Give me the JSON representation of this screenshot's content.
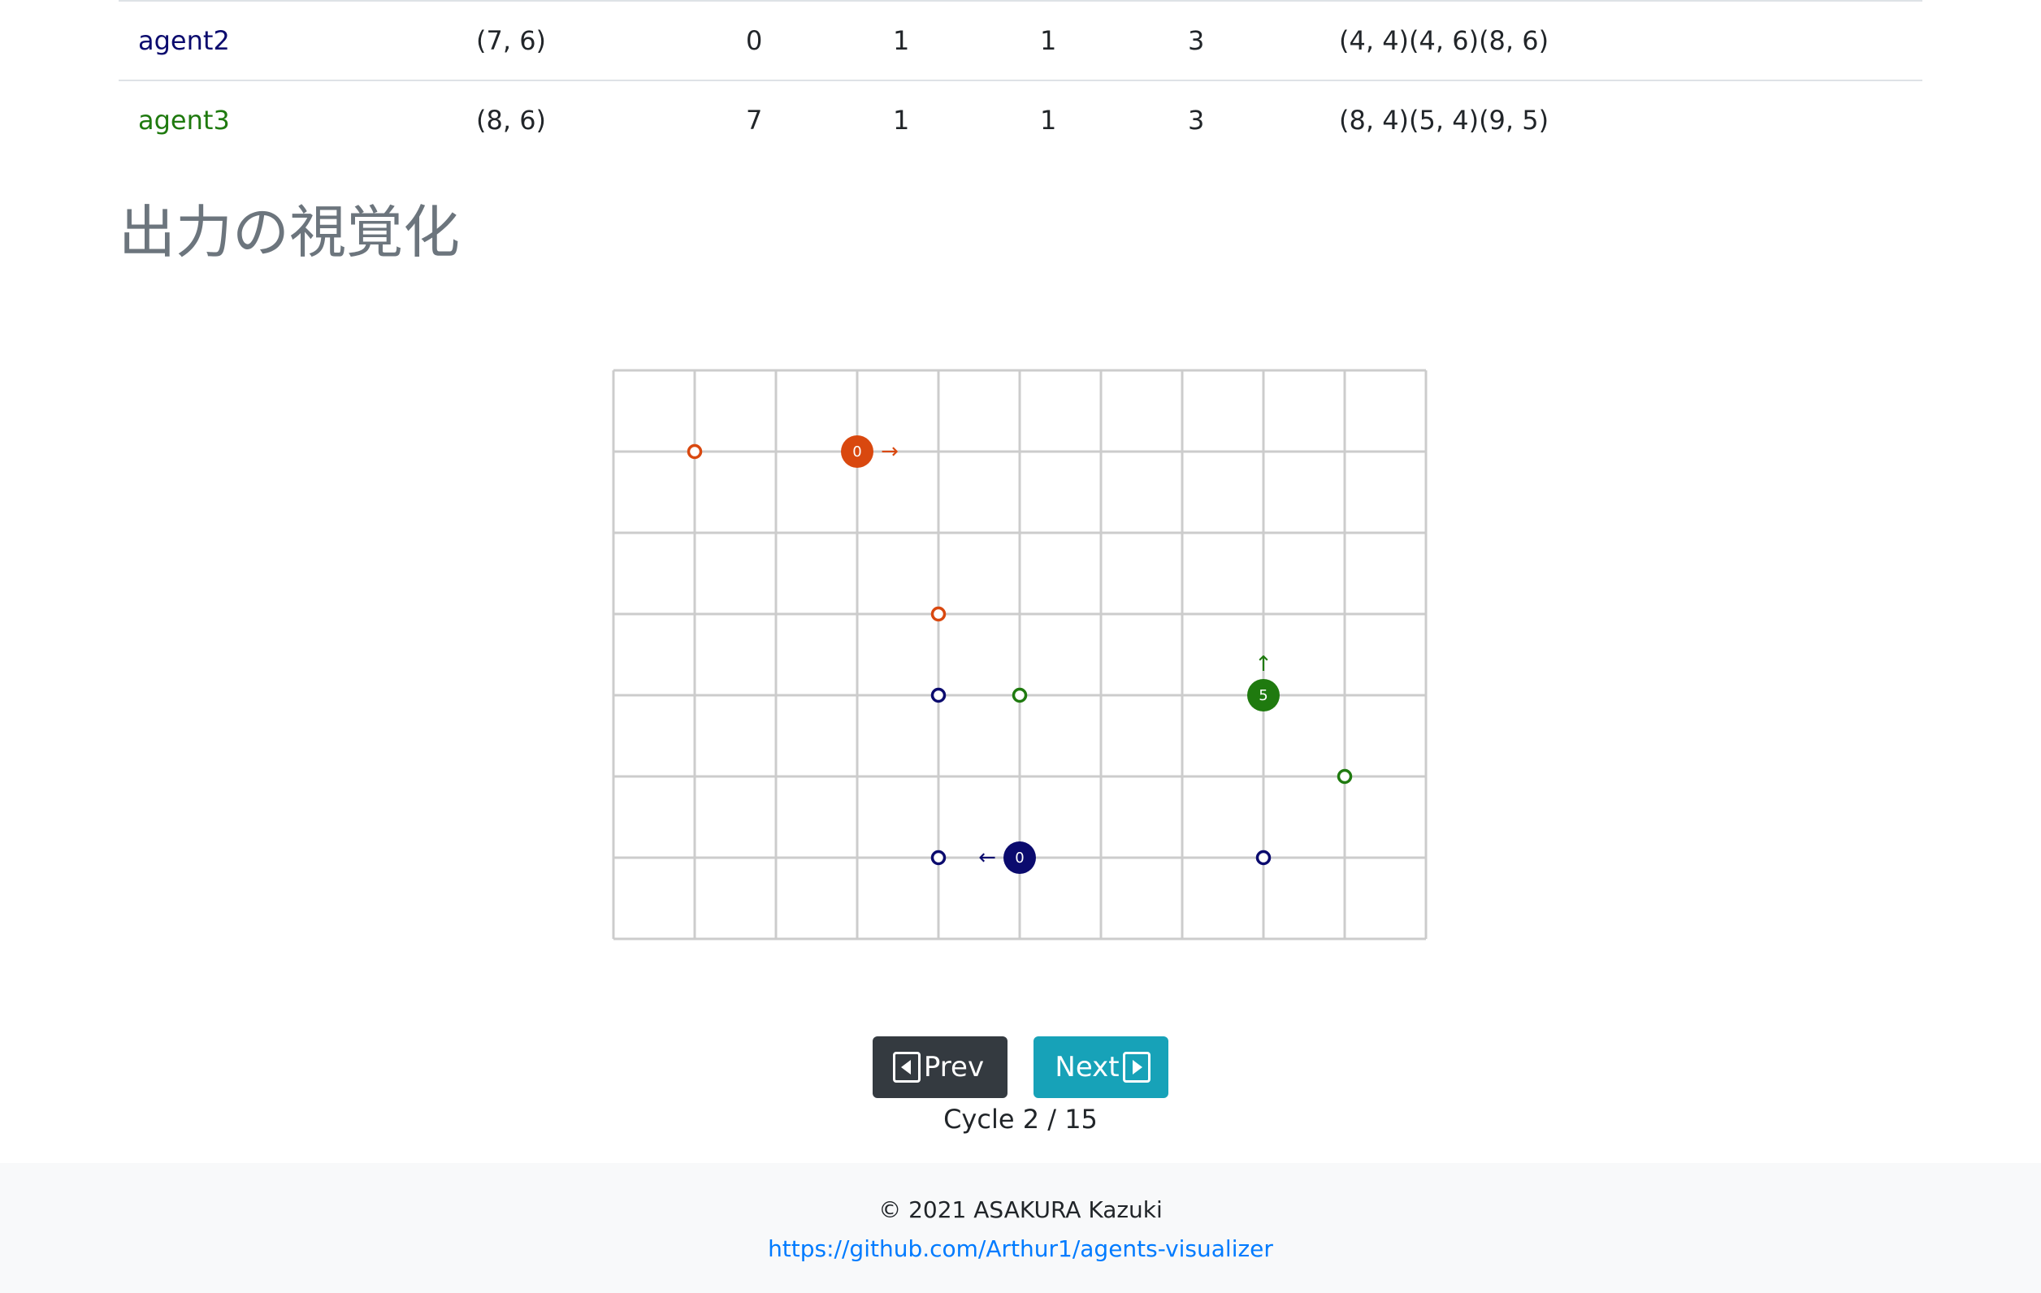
{
  "agents_table": {
    "rows": [
      {
        "name": "agent2",
        "color": "#0b0b6e",
        "start": "(7, 6)",
        "col_a": "0",
        "col_b": "1",
        "col_c": "1",
        "col_d": "3",
        "targets": "(4, 4)(4, 6)(8, 6)"
      },
      {
        "name": "agent3",
        "color": "#1f7a0f",
        "start": "(8, 6)",
        "col_a": "7",
        "col_b": "1",
        "col_c": "1",
        "col_d": "3",
        "targets": "(8, 4)(5, 4)(9, 5)"
      }
    ]
  },
  "section_title": "出力の視覚化",
  "visualization": {
    "grid": {
      "columns": 10,
      "rows": 7,
      "line_color": "#cccccc"
    },
    "targets": [
      {
        "x": 1,
        "y": 1,
        "color": "#d9480f"
      },
      {
        "x": 4,
        "y": 3,
        "color": "#d9480f"
      },
      {
        "x": 4,
        "y": 4,
        "color": "#0b0b6e"
      },
      {
        "x": 4,
        "y": 6,
        "color": "#0b0b6e"
      },
      {
        "x": 8,
        "y": 6,
        "color": "#0b0b6e"
      },
      {
        "x": 5,
        "y": 4,
        "color": "#1f7a0f"
      },
      {
        "x": 9,
        "y": 5,
        "color": "#1f7a0f"
      }
    ],
    "agents": [
      {
        "x": 3,
        "y": 1,
        "color": "#d9480f",
        "label": "0",
        "arrow": "→",
        "direction": "right"
      },
      {
        "x": 5,
        "y": 6,
        "color": "#0b0b6e",
        "label": "0",
        "arrow": "←",
        "direction": "left"
      },
      {
        "x": 8,
        "y": 4,
        "color": "#1f7a0f",
        "label": "5",
        "arrow": "↑",
        "direction": "up"
      }
    ]
  },
  "controls": {
    "prev_label": "Prev",
    "next_label": "Next",
    "cycle_text": "Cycle 2 / 15"
  },
  "footer": {
    "copyright": "© 2021 ASAKURA Kazuki",
    "link_text": "https://github.com/Arthur1/agents-visualizer"
  }
}
